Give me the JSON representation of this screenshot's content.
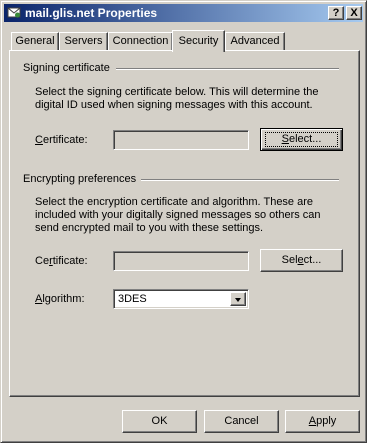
{
  "window": {
    "title": "mail.glis.net Properties",
    "help_glyph": "?",
    "close_glyph": "X"
  },
  "tabs": [
    {
      "label": "General",
      "active": false
    },
    {
      "label": "Servers",
      "active": false
    },
    {
      "label": "Connection",
      "active": false
    },
    {
      "label": "Security",
      "active": true
    },
    {
      "label": "Advanced",
      "active": false
    }
  ],
  "signing": {
    "heading": "Signing certificate",
    "description": "Select the signing certificate below. This will determine the digital ID used when signing messages with this account.",
    "certificate_label_prefix": "C",
    "certificate_label_rest": "ertificate:",
    "certificate_value": "",
    "select_label_prefix": "",
    "select_label_mnemonic": "S",
    "select_label_rest": "elect..."
  },
  "encrypting": {
    "heading": "Encrypting preferences",
    "description": "Select the encryption certificate and algorithm. These are included with your digitally signed messages so others can send encrypted mail to you with these settings.",
    "certificate_label_prefix": "Ce",
    "certificate_label_mnemonic": "r",
    "certificate_label_rest": "tificate:",
    "certificate_value": "",
    "select_label_prefix": "Sel",
    "select_label_mnemonic": "e",
    "select_label_rest": "ct...",
    "algorithm_label_prefix": "",
    "algorithm_label_mnemonic": "A",
    "algorithm_label_rest": "lgorithm:",
    "algorithm_value": "3DES"
  },
  "footer": {
    "ok": "OK",
    "cancel": "Cancel",
    "apply_mnemonic": "A",
    "apply_rest": "pply"
  }
}
